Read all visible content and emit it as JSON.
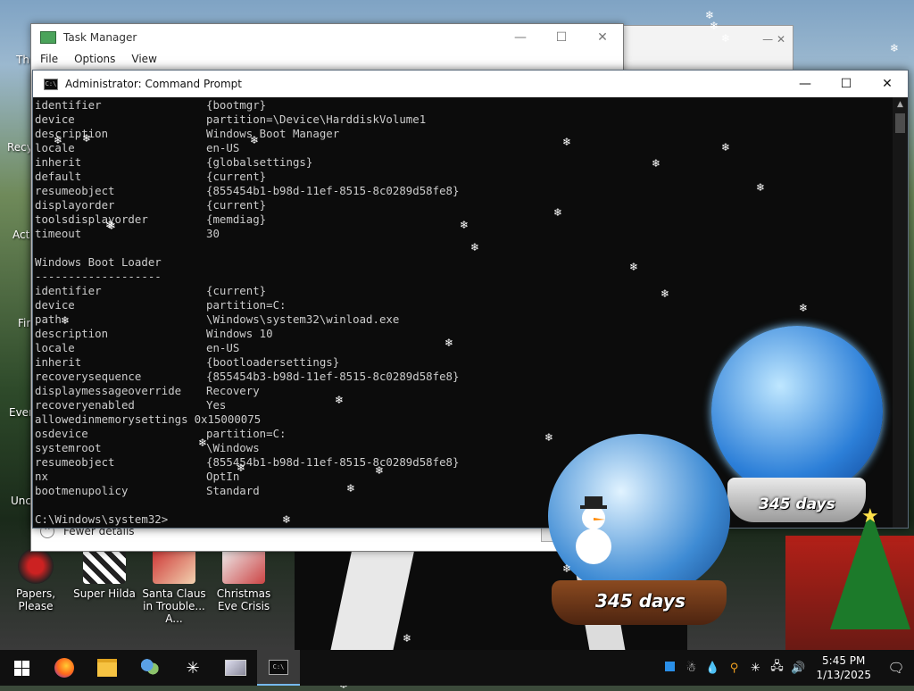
{
  "taskmanager": {
    "title": "Task Manager",
    "menu": [
      "File",
      "Options",
      "View"
    ],
    "fewer_details": "Fewer details"
  },
  "cmd": {
    "title": "Administrator: Command Prompt",
    "lines": [
      {
        "k": "identifier",
        "v": "{bootmgr}"
      },
      {
        "k": "device",
        "v": "partition=\\Device\\HarddiskVolume1"
      },
      {
        "k": "description",
        "v": "Windows Boot Manager"
      },
      {
        "k": "locale",
        "v": "en-US"
      },
      {
        "k": "inherit",
        "v": "{globalsettings}"
      },
      {
        "k": "default",
        "v": "{current}"
      },
      {
        "k": "resumeobject",
        "v": "{855454b1-b98d-11ef-8515-8c0289d58fe8}"
      },
      {
        "k": "displayorder",
        "v": "{current}"
      },
      {
        "k": "toolsdisplayorder",
        "v": "{memdiag}"
      },
      {
        "k": "timeout",
        "v": "30"
      },
      {
        "k": "",
        "v": ""
      },
      {
        "k": "Windows Boot Loader",
        "v": ""
      },
      {
        "k": "-------------------",
        "v": ""
      },
      {
        "k": "identifier",
        "v": "{current}"
      },
      {
        "k": "device",
        "v": "partition=C:"
      },
      {
        "k": "path",
        "v": "\\Windows\\system32\\winload.exe"
      },
      {
        "k": "description",
        "v": "Windows 10"
      },
      {
        "k": "locale",
        "v": "en-US"
      },
      {
        "k": "inherit",
        "v": "{bootloadersettings}"
      },
      {
        "k": "recoverysequence",
        "v": "{855454b3-b98d-11ef-8515-8c0289d58fe8}"
      },
      {
        "k": "displaymessageoverride",
        "v": "Recovery"
      },
      {
        "k": "recoveryenabled",
        "v": "Yes"
      },
      {
        "k": "allowedinmemorysettings",
        "v": "0x15000075"
      },
      {
        "k": "osdevice",
        "v": "partition=C:"
      },
      {
        "k": "systemroot",
        "v": "\\Windows"
      },
      {
        "k": "resumeobject",
        "v": "{855454b1-b98d-11ef-8515-8c0289d58fe8}"
      },
      {
        "k": "nx",
        "v": "OptIn"
      },
      {
        "k": "bootmenupolicy",
        "v": "Standard"
      },
      {
        "k": "",
        "v": ""
      },
      {
        "k": "C:\\Windows\\system32>",
        "v": ""
      }
    ]
  },
  "desktop_icons": [
    {
      "label": "Papers, Please"
    },
    {
      "label": "Super Hilda"
    },
    {
      "label": "Santa Claus in Trouble... A..."
    },
    {
      "label": "Christmas Eve Crisis"
    }
  ],
  "edge_labels": [
    "Th",
    "Recy",
    "Acti",
    "Fir",
    "Ever",
    "Unc"
  ],
  "globes": {
    "days_label": "345 days"
  },
  "taskbar": {
    "apps": [
      "start-icon",
      "firefox-icon",
      "file-explorer-icon",
      "people-icon",
      "snowflake-icon",
      "photos-icon",
      "command-prompt-icon"
    ],
    "time": "5:45 PM",
    "date": "1/13/2025"
  },
  "colors": {
    "console_bg": "#0c0c0c",
    "console_fg": "#cccccc",
    "taskbar": "#101010"
  }
}
